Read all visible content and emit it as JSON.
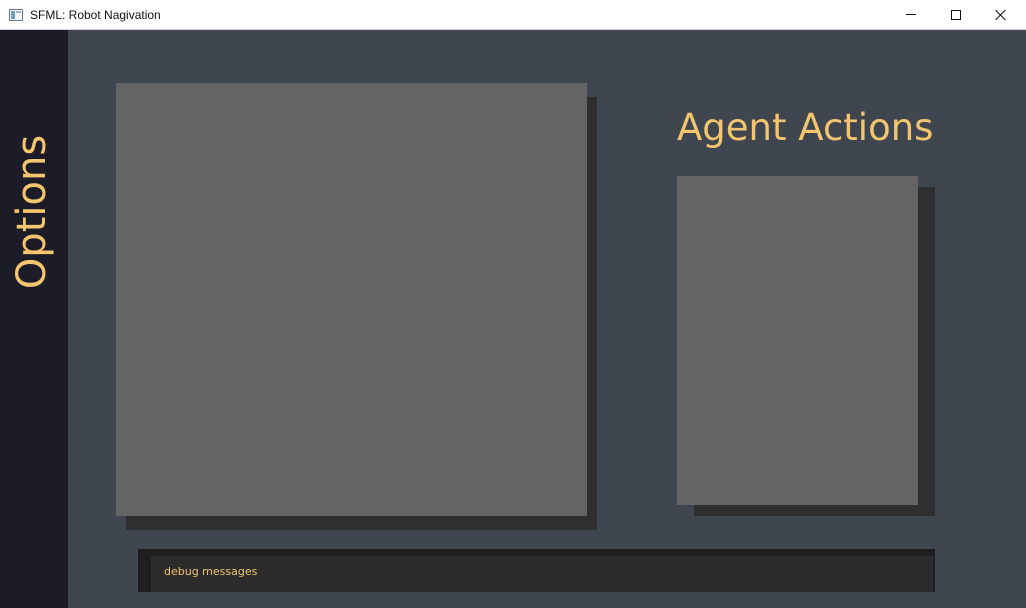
{
  "window": {
    "title": "SFML: Robot Nagivation",
    "icon": "app-window-icon",
    "controls": {
      "minimize": "minimize-icon",
      "maximize": "maximize-icon",
      "close": "close-icon"
    }
  },
  "sidebar": {
    "label": "Options"
  },
  "actions_panel": {
    "title": "Agent Actions"
  },
  "debug": {
    "message": "debug messages"
  },
  "colors": {
    "background": "#3f4650",
    "sidebar": "#1c1c29",
    "panel": "#646464",
    "panel_shadow": "#2f2f2f",
    "accent_text": "#f3c56f",
    "debug_bar": "#2c2c2c"
  }
}
